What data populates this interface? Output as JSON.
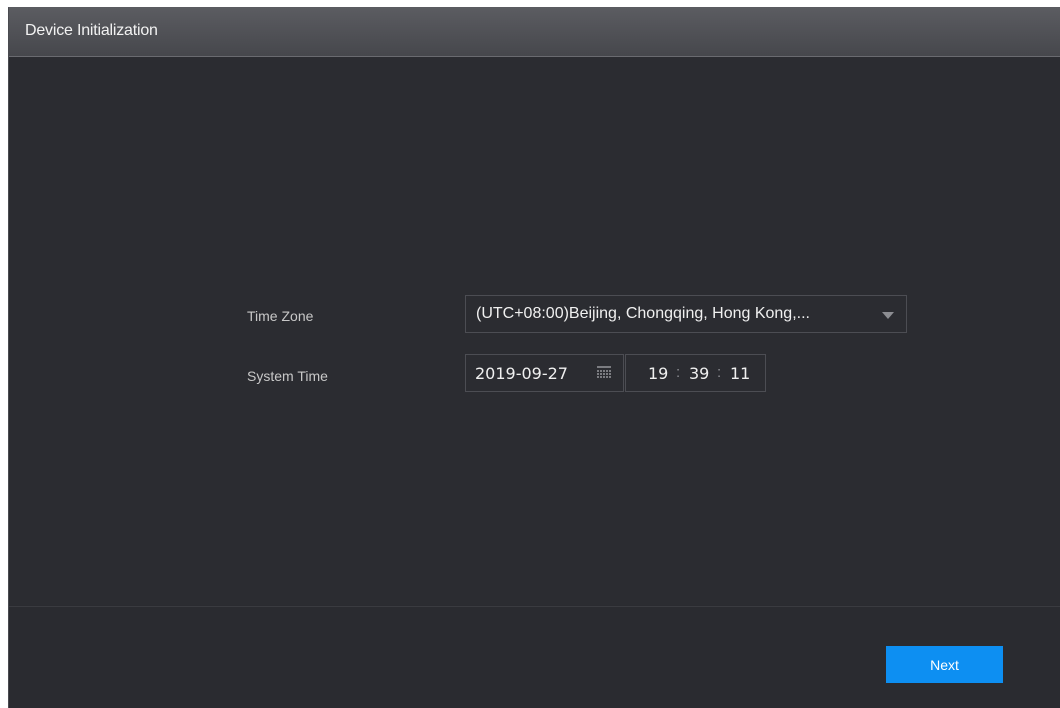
{
  "window": {
    "title": "Device Initialization"
  },
  "form": {
    "time_zone_label": "Time Zone",
    "time_zone_value": "(UTC+08:00)Beijing, Chongqing, Hong Kong,...",
    "system_time_label": "System Time",
    "date_value": "2019-09-27",
    "time_hours": "19",
    "time_minutes": "39",
    "time_seconds": "11",
    "time_separator": ":"
  },
  "footer": {
    "next_label": "Next"
  },
  "colors": {
    "accent": "#0d8ff2",
    "background": "#2b2c31",
    "titlebar": "#505156"
  },
  "icons": {
    "dropdown": "chevron-down-icon",
    "calendar": "calendar-icon"
  }
}
